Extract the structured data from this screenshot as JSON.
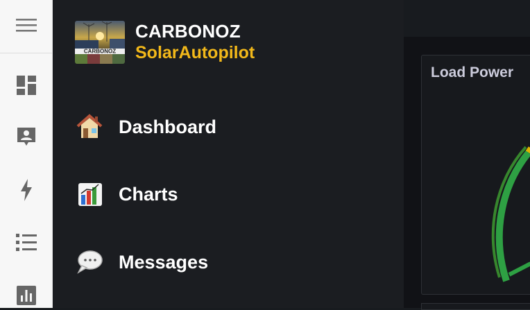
{
  "rail": {
    "icons": [
      "hamburger-menu-icon",
      "dashboard-grid-icon",
      "contact-card-icon",
      "lightning-icon",
      "list-icon",
      "bar-chart-icon"
    ]
  },
  "brand": {
    "logo_text": "CARBONOZ",
    "name": "CARBONOZ",
    "subtitle": "SolarAutopilot",
    "subtitle_color": "#f2b81a"
  },
  "nav": {
    "items": [
      {
        "label": "Dashboard",
        "icon": "house-icon"
      },
      {
        "label": "Charts",
        "icon": "bar-chart-colored-icon"
      },
      {
        "label": "Messages",
        "icon": "speech-bubble-icon"
      }
    ]
  },
  "panel": {
    "title": "Load Power"
  }
}
